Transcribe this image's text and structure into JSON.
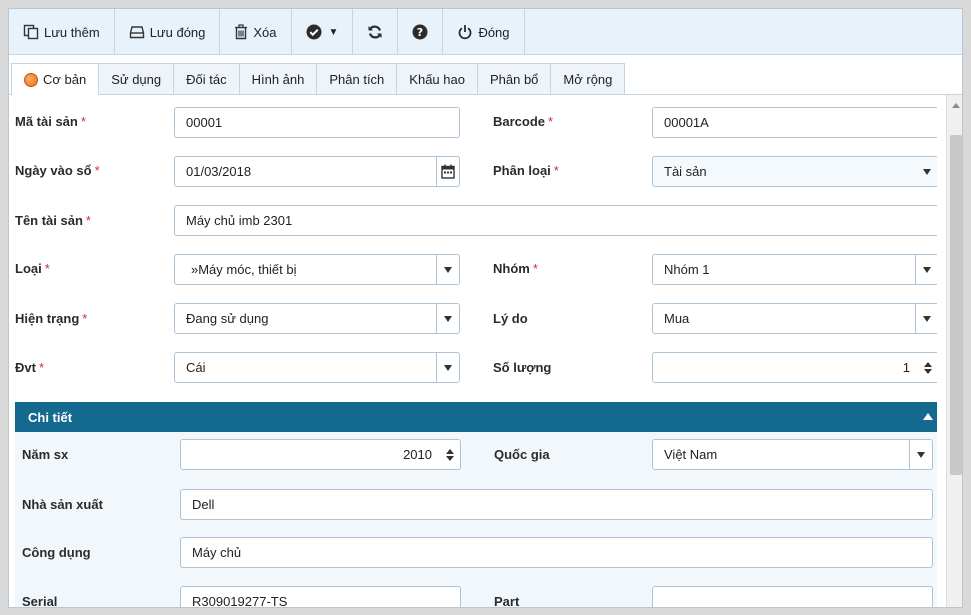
{
  "toolbar": {
    "save_more": "Lưu thêm",
    "save_close": "Lưu đóng",
    "delete": "Xóa",
    "close": "Đóng"
  },
  "tabs": [
    "Cơ bản",
    "Sử dụng",
    "Đối tác",
    "Hình ảnh",
    "Phân tích",
    "Khấu hao",
    "Phân bổ",
    "Mở rộng"
  ],
  "form": {
    "ma_tai_san": {
      "label": "Mã tài sản",
      "value": "00001"
    },
    "barcode": {
      "label": "Barcode",
      "value": "00001A"
    },
    "ngay_vao_so": {
      "label": "Ngày vào sổ",
      "value": "01/03/2018"
    },
    "phan_loai": {
      "label": "Phân loại",
      "value": "Tài sản"
    },
    "ten_tai_san": {
      "label": "Tên tài sản",
      "value": "Máy chủ imb 2301"
    },
    "loai": {
      "label": "Loại",
      "value": "»Máy móc, thiết bị"
    },
    "nhom": {
      "label": "Nhóm",
      "value": "Nhóm 1"
    },
    "hien_trang": {
      "label": "Hiện trạng",
      "value": "Đang sử dụng"
    },
    "ly_do": {
      "label": "Lý do",
      "value": "Mua"
    },
    "dvt": {
      "label": "Đvt",
      "value": "Cái"
    },
    "so_luong": {
      "label": "Số lượng",
      "value": "1"
    },
    "required_mark": "*"
  },
  "detail": {
    "title": "Chi tiết",
    "nam_sx": {
      "label": "Năm sx",
      "value": "2010"
    },
    "quoc_gia": {
      "label": "Quốc gia",
      "value": "Việt Nam"
    },
    "nha_san_xuat": {
      "label": "Nhà sản xuất",
      "value": "Dell"
    },
    "cong_dung": {
      "label": "Công dụng",
      "value": "Máy chủ"
    },
    "serial": {
      "label": "Serial",
      "value": "R309019277-TS"
    },
    "part": {
      "label": "Part",
      "value": ""
    }
  },
  "colors": {
    "section_header": "#136a8e",
    "required": "#d52b2b",
    "toolbar_bg": "#e8f2fa"
  },
  "icons": [
    "copy-icon",
    "save-icon",
    "trash-icon",
    "check-circle-icon",
    "refresh-icon",
    "help-icon",
    "power-icon",
    "calendar-icon"
  ]
}
